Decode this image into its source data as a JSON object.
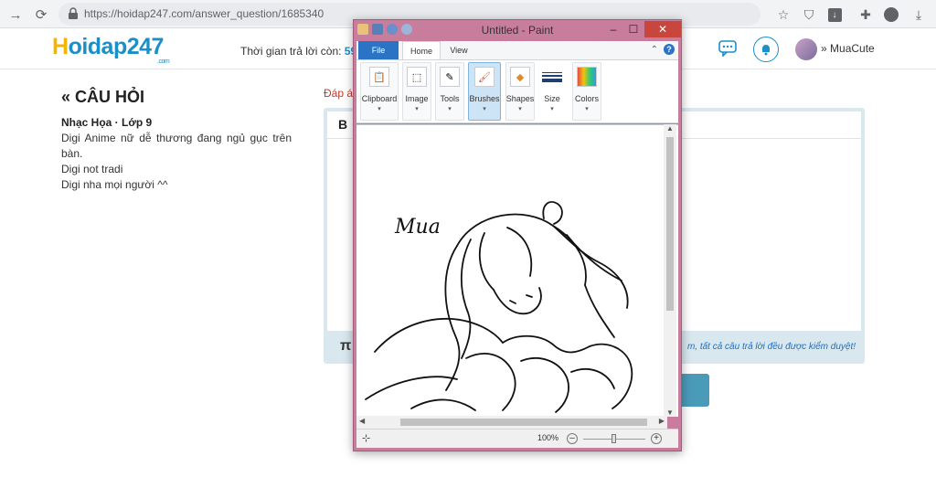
{
  "browser": {
    "url": "https://hoidap247.com/answer_question/1685340"
  },
  "site": {
    "logo_h": "H",
    "logo_rest": "oidap247",
    "logo_com": ".com",
    "timer_label": "Thời gian trả lời còn:",
    "timer_value": "59",
    "username": "MuaCute"
  },
  "question": {
    "title": "CÂU HỎI",
    "subject": "Nhạc Họa · Lớp 9",
    "lines": [
      "Digi Anime nữ dễ thương đang ngủ gục trên bàn.",
      "Digi not tradi",
      "Digi nha mọi người ^^"
    ]
  },
  "answer": {
    "label": "Đáp á",
    "bold_button": "B",
    "pi_button": "π",
    "moderation_note": "m, tất cả câu trả lời đều được kiểm duyệt!"
  },
  "paint": {
    "title": "Untitled - Paint",
    "tabs": [
      "File",
      "Home",
      "View"
    ],
    "groups": [
      "Clipboard",
      "Image",
      "Tools",
      "Brushes",
      "Shapes",
      "Size",
      "Colors"
    ],
    "zoom": "100%",
    "zoom_fraction": 0.5,
    "signature": "Mua"
  },
  "colors": {
    "brand_blue": "#1a8fc8",
    "brand_yellow": "#f4b400",
    "paint_frame": "#c97d9c",
    "answer_red": "#c0392b"
  }
}
